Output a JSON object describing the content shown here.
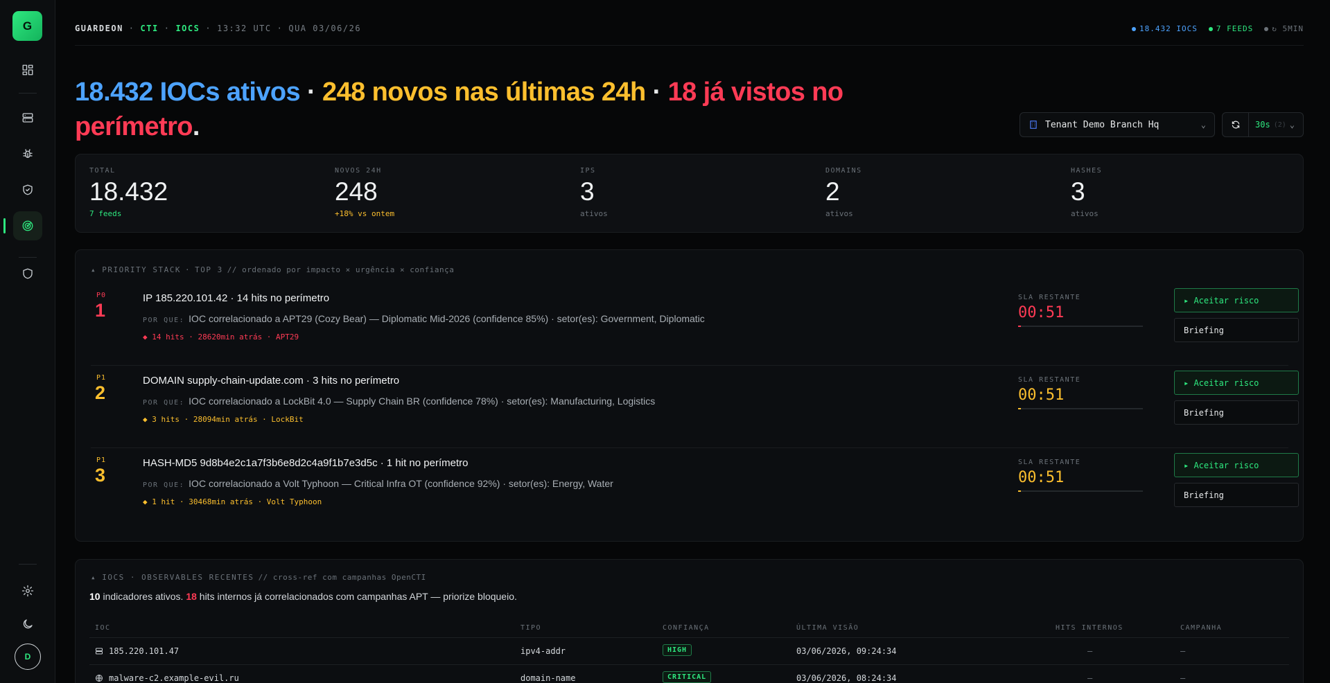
{
  "sidebar": {
    "logo_letter": "G",
    "avatar_letter": "D",
    "items": [
      {
        "icon": "dashboard-icon"
      },
      {
        "icon": "server-icon"
      },
      {
        "icon": "bug-icon"
      },
      {
        "icon": "shield-check-icon"
      },
      {
        "icon": "radar-icon",
        "active": true
      },
      {
        "icon": "shield-icon"
      },
      {
        "icon": "gear-icon"
      },
      {
        "icon": "moon-icon"
      }
    ]
  },
  "topbar": {
    "brand": "GUARDEON",
    "section": "CTI",
    "page": "IOCS",
    "time": "13:32 UTC",
    "date": "QUA 03/06/26",
    "sep": "·",
    "iocs": "18.432 IOCS",
    "feeds": "7 FEEDS",
    "refresh": "↻ 5MIN"
  },
  "headline": {
    "part1": "18.432 IOCs ativos",
    "sep": " · ",
    "part2": "248 novos nas últimas 24h",
    "part3": "18 já vistos no perímetro",
    "end": "."
  },
  "tenant": {
    "label": "Tenant Demo Branch Hq"
  },
  "refresh": {
    "interval": "30s",
    "hint": "(2)"
  },
  "stats": [
    {
      "label": "TOTAL",
      "value": "18.432",
      "sub": "7 feeds",
      "sub_color": "#2ee87f"
    },
    {
      "label": "NOVOS 24H",
      "value": "248",
      "sub": "+18% vs ontem",
      "sub_color": "#fcbf2e"
    },
    {
      "label": "IPS",
      "value": "3",
      "sub": "ativos",
      "sub_color": "#6b7279"
    },
    {
      "label": "DOMAINS",
      "value": "2",
      "sub": "ativos",
      "sub_color": "#6b7279"
    },
    {
      "label": "HASHES",
      "value": "3",
      "sub": "ativos",
      "sub_color": "#6b7279"
    }
  ],
  "priority": {
    "header": "▴ PRIORITY STACK",
    "dot": "·",
    "top": "TOP 3",
    "comment": "// ordenado por impacto × urgência × confiança",
    "reason_label": "POR QUE:",
    "sla_label": "SLA RESTANTE",
    "accept_label": "▸ Aceitar risco",
    "brief_label": "Briefing",
    "items": [
      {
        "level": "P0",
        "rank": "1",
        "color": "#ff3b55",
        "title": "IP 185.220.101.42 · 14 hits no perímetro",
        "reason": "IOC correlacionado a APT29 (Cozy Bear) — Diplomatic Mid-2026 (confidence 85%) · setor(es): Government, Diplomatic",
        "meta": "◆ 14 hits · 28620min atrás · APT29",
        "sla": "00:51",
        "sla_fraction": 0.02
      },
      {
        "level": "P1",
        "rank": "2",
        "color": "#fcbf2e",
        "title": "DOMAIN supply-chain-update.com · 3 hits no perímetro",
        "reason": "IOC correlacionado a LockBit 4.0 — Supply Chain BR (confidence 78%) · setor(es): Manufacturing, Logistics",
        "meta": "◆ 3 hits · 28094min atrás · LockBit",
        "sla": "00:51",
        "sla_fraction": 0.02
      },
      {
        "level": "P1",
        "rank": "3",
        "color": "#fcbf2e",
        "title": "HASH-MD5 9d8b4e2c1a7f3b6e8d2c4a9f1b7e3d5c · 1 hit no perímetro",
        "reason": "IOC correlacionado a Volt Typhoon — Critical Infra OT (confidence 92%) · setor(es): Energy, Water",
        "meta": "◆ 1 hit · 30468min atrás · Volt Typhoon",
        "sla": "00:51",
        "sla_fraction": 0.02
      }
    ]
  },
  "iocs": {
    "header": "▴ IOCS · OBSERVABLES RECENTES",
    "comment": "// cross-ref com campanhas OpenCTI",
    "summary_count": "10",
    "summary_text1": " indicadores ativos. ",
    "summary_hits": "18",
    "summary_text2": " hits internos já correlacionados com campanhas APT — priorize bloqueio.",
    "columns": [
      "IOC",
      "TIPO",
      "CONFIANÇA",
      "ÚLTIMA VISÃO",
      "HITS INTERNOS",
      "CAMPANHA"
    ],
    "rows": [
      {
        "icon": "server-icon",
        "ioc": "185.220.101.47",
        "type": "ipv4-addr",
        "confidence": "HIGH",
        "last_seen": "03/06/2026, 09:24:34",
        "hits": "—",
        "campaign": "—"
      },
      {
        "icon": "globe-icon",
        "ioc": "malware-c2.example-evil.ru",
        "type": "domain-name",
        "confidence": "CRITICAL",
        "last_seen": "03/06/2026, 08:24:34",
        "hits": "—",
        "campaign": "—"
      }
    ]
  }
}
